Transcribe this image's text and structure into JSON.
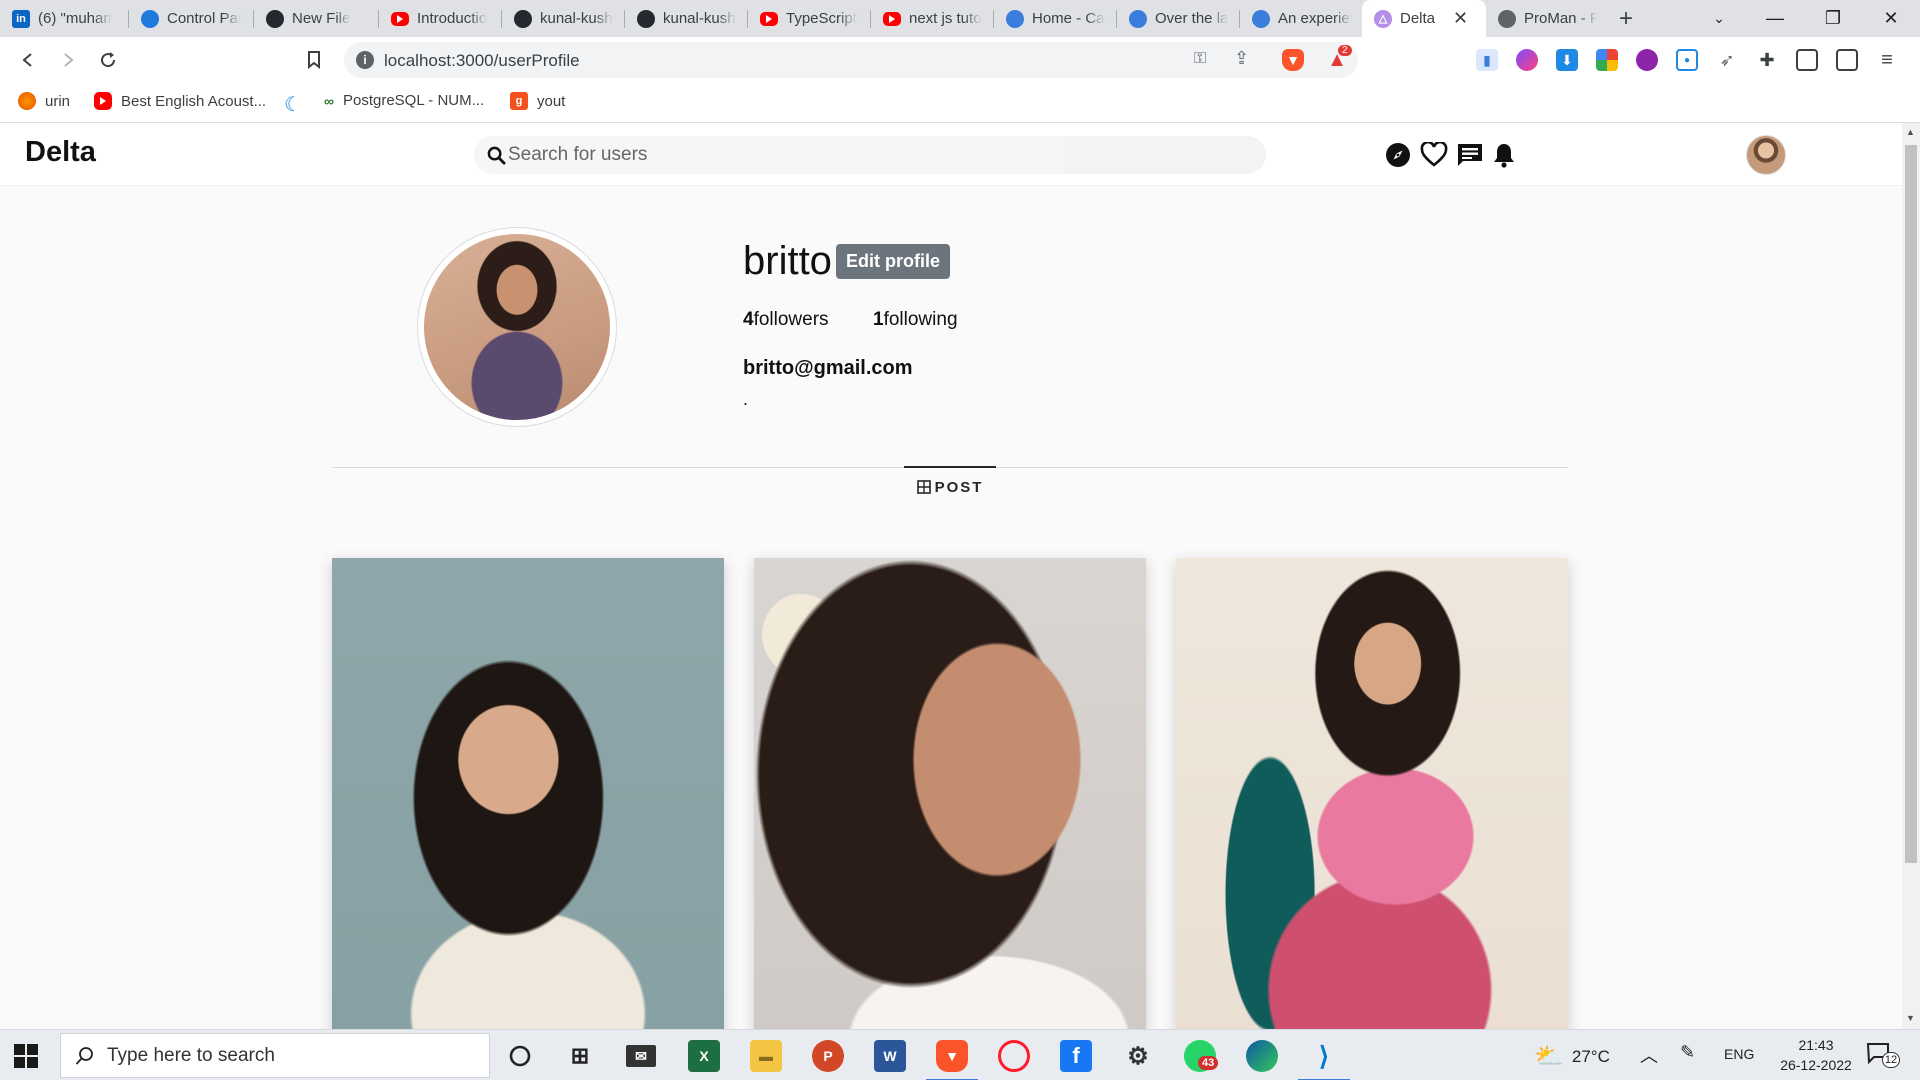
{
  "browser": {
    "tabs": [
      {
        "title": "(6) \"muham",
        "icon": "linkedin-icon"
      },
      {
        "title": "Control Pan",
        "icon": "control-panel-icon"
      },
      {
        "title": "New File",
        "icon": "github-icon"
      },
      {
        "title": "Introductio",
        "icon": "youtube-icon"
      },
      {
        "title": "kunal-kush",
        "icon": "github-icon"
      },
      {
        "title": "kunal-kush",
        "icon": "github-icon"
      },
      {
        "title": "TypeScript",
        "icon": "youtube-icon"
      },
      {
        "title": "next js tuto",
        "icon": "youtube-icon"
      },
      {
        "title": "Home - Ca",
        "icon": "edge-icon"
      },
      {
        "title": "Over the la",
        "icon": "edge-icon"
      },
      {
        "title": "An experien",
        "icon": "edge-icon"
      },
      {
        "title": "Delta",
        "icon": "delta-icon",
        "active": true
      },
      {
        "title": "ProMan - P",
        "icon": "globe-icon"
      }
    ],
    "url": "localhost:3000/userProfile",
    "bookmarks": [
      {
        "label": "urin",
        "icon": "firefox-icon"
      },
      {
        "label": "Best English Acoust...",
        "icon": "youtube-icon"
      },
      {
        "label": "",
        "icon": "moon-icon"
      },
      {
        "label": "PostgreSQL - NUM...",
        "icon": "postgres-icon"
      },
      {
        "label": "yout",
        "icon": "g-icon"
      }
    ],
    "brave_badge": "2"
  },
  "app": {
    "logo": "Delta",
    "search_placeholder": "Search for users"
  },
  "profile": {
    "username": "britto",
    "edit_label": "Edit profile",
    "followers_count": "4",
    "followers_label": "followers",
    "following_count": "1",
    "following_label": "following",
    "email": "britto@gmail.com",
    "bio": "."
  },
  "tabs": {
    "post_label": "POST"
  },
  "taskbar": {
    "search_placeholder": "Type here to search",
    "whatsapp_badge": "43",
    "temperature": "27°C",
    "language": "ENG",
    "time": "21:43",
    "date": "26-12-2022",
    "notification_count": "12"
  },
  "colors": {
    "edit_button": "#6c757d",
    "page_bg": "#fafafa",
    "accent": "#3b7ddd"
  }
}
